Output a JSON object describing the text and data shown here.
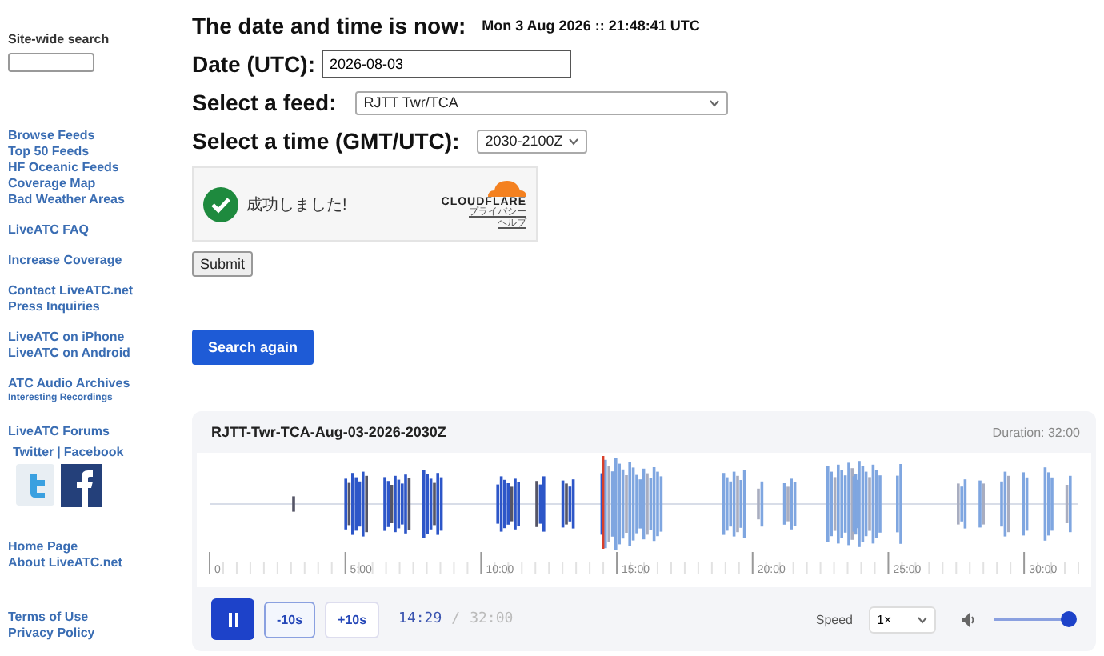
{
  "sidebar": {
    "search_label": "Site-wide search",
    "link_groups": [
      [
        {
          "label": "Browse Feeds",
          "kind": "link"
        },
        {
          "label": "Top 50 Feeds",
          "kind": "link"
        },
        {
          "label": "HF Oceanic Feeds",
          "kind": "link"
        },
        {
          "label": "Coverage Map",
          "kind": "link"
        },
        {
          "label": "Bad Weather Areas",
          "kind": "link"
        }
      ],
      [
        {
          "label": "LiveATC FAQ",
          "kind": "link"
        }
      ],
      [
        {
          "label": "Increase Coverage",
          "kind": "link"
        }
      ],
      [
        {
          "label": "Contact LiveATC.net",
          "kind": "link"
        },
        {
          "label": "Press Inquiries",
          "kind": "link"
        }
      ],
      [
        {
          "label": "LiveATC on iPhone",
          "kind": "link"
        },
        {
          "label": "LiveATC on Android",
          "kind": "link"
        }
      ],
      [
        {
          "label": "ATC Audio Archives",
          "kind": "link"
        },
        {
          "label": "Interesting Recordings",
          "kind": "small"
        }
      ],
      [
        {
          "label": "LiveATC Forums",
          "kind": "link"
        }
      ],
      [
        {
          "label": "Home Page",
          "kind": "link"
        },
        {
          "label": "About LiveATC.net",
          "kind": "link"
        }
      ],
      [
        {
          "label": "Terms of Use",
          "kind": "link"
        },
        {
          "label": "Privacy Policy",
          "kind": "link"
        }
      ]
    ],
    "social": {
      "links": [
        "Twitter",
        "Facebook"
      ],
      "separator": "|"
    }
  },
  "form": {
    "now_label": "The date and time is now:",
    "now_value": "Mon 3 Aug 2026 :: 21:48:41 UTC",
    "date_label": "Date (UTC):",
    "date_value": "2026-08-03",
    "feed_label": "Select a feed:",
    "feed_value": "RJTT Twr/TCA",
    "time_label": "Select a time (GMT/UTC):",
    "time_value": "2030-2100Z",
    "captcha": {
      "status": "成功しました!",
      "brand": "CLOUDFLARE",
      "links": [
        "プライバシー",
        "ヘルプ"
      ]
    },
    "submit": "Submit",
    "search_again": "Search again"
  },
  "player": {
    "title": "RJTT-Twr-TCA-Aug-03-2026-2030Z",
    "duration": "Duration: 32:00",
    "ticks": [
      "0",
      "5:00",
      "10:00",
      "15:00",
      "20:00",
      "25:00",
      "30:00"
    ],
    "level": 0.453,
    "back": "-10s",
    "forward": "+10s",
    "current": "14:29",
    "separator": "/",
    "total": "32:00",
    "speed_label": "Speed",
    "speed_value": "1×",
    "volume": {
      "level": 1.0
    }
  }
}
